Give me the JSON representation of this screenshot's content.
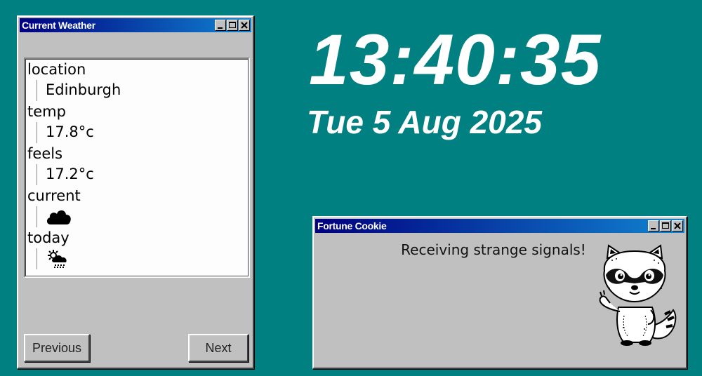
{
  "weather_window": {
    "title": "Current Weather",
    "entries": [
      {
        "key": "location",
        "value": "Edinburgh"
      },
      {
        "key": "temp",
        "value": "17.8°c"
      },
      {
        "key": "feels",
        "value": "17.2°c"
      },
      {
        "key": "current",
        "icon": "cloud-icon"
      },
      {
        "key": "today",
        "icon": "sun-cloud-rain-icon"
      }
    ],
    "previous_label": "Previous",
    "next_label": "Next"
  },
  "clock": {
    "time": "13:40:35",
    "date": "Tue 5 Aug 2025"
  },
  "fortune_window": {
    "title": "Fortune Cookie",
    "message": "Receiving strange signals!",
    "mascot_icon": "raccoon-icon"
  },
  "colors": {
    "desktop": "#008080",
    "titlebar_start": "#000080",
    "titlebar_end": "#1084d0",
    "window_face": "#c0c0c0"
  }
}
